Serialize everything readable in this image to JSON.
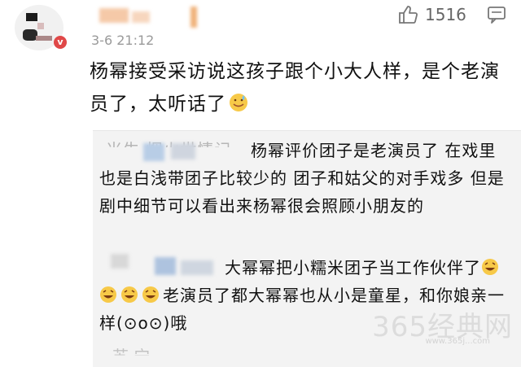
{
  "comment": {
    "timestamp": "3-6 21:12",
    "like_count": "1516",
    "text": "杨幂接受采访说这孩子跟个小大人样，是个老演员了，太听话了",
    "emoji": "sweat-smile-emoji"
  },
  "replies": {
    "first": {
      "author_fragment": "米生 烟火世情记",
      "text": "杨幂评价团子是老演员了 在戏里也是白浅带团子比较少的 团子和姑父的对手戏多 但是剧中细节可以看出来杨幂很会照顾小朋友的"
    },
    "second": {
      "text_a": "大幂幂把小糯米团子当工作伙伴了",
      "text_b": "老演员了都大幂幂也从小是童星，和你娘亲一样(⊙o⊙)哦",
      "emoji": "laughing-tears-emoji"
    },
    "third_fragment": "苏 宁 一 一"
  },
  "watermark": {
    "text": "365经典网",
    "url": "www.365j...com"
  },
  "icons": {
    "like": "thumbs-up-icon",
    "reply": "comment-bubble-icon"
  },
  "colors": {
    "timestamp": "#9a9a9a",
    "panel": "#f3f3f3"
  }
}
